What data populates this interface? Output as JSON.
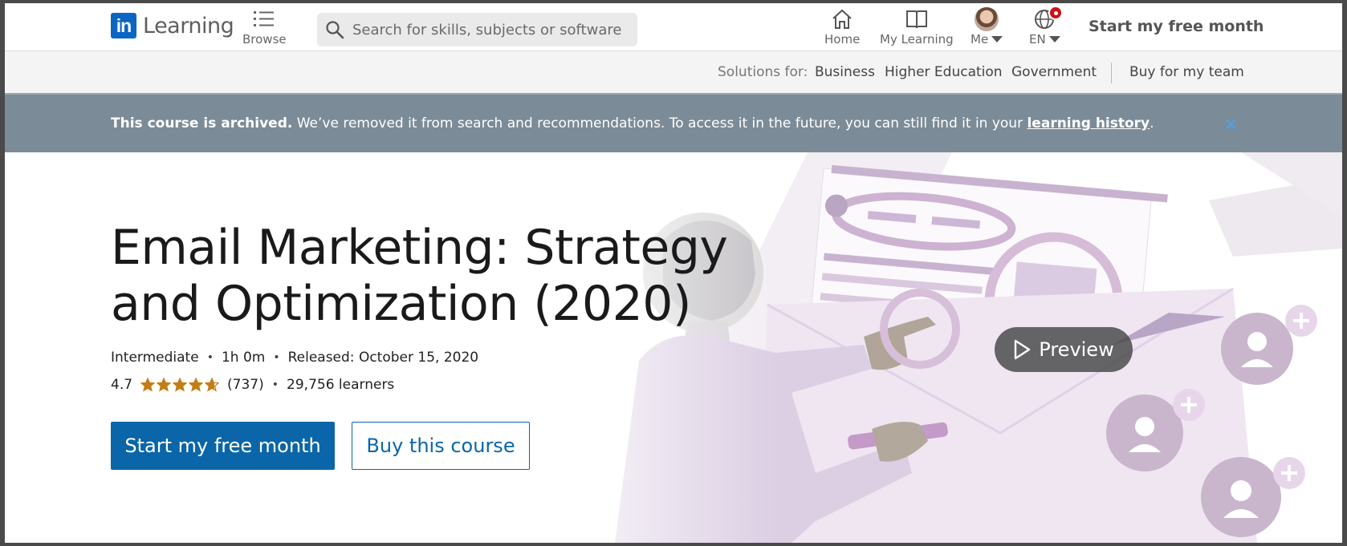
{
  "nav": {
    "logo_mark": "in",
    "logo_text": "Learning",
    "browse_label": "Browse",
    "search_placeholder": "Search for skills, subjects or software",
    "home_label": "Home",
    "my_learning_label": "My Learning",
    "me_label": "Me",
    "language_label": "EN",
    "cta_label": "Start my free month"
  },
  "subnav": {
    "solutions_label": "Solutions for:",
    "items": [
      "Business",
      "Higher Education",
      "Government"
    ],
    "team_label": "Buy for my team"
  },
  "banner": {
    "bold": "This course is archived.",
    "text": " We’ve removed it from search and recommendations. To access it in the future, you can still find it in your ",
    "link": "learning history",
    "end": ".",
    "close_glyph": "✕"
  },
  "course": {
    "title": "Email Marketing: Strategy and Optimization (2020)",
    "level": "Intermediate",
    "duration": "1h 0m",
    "released": "Released: October 15, 2020",
    "rating": "4.7",
    "rating_value": 4.7,
    "reviews": "(737)",
    "learners": "29,756 learners",
    "primary_cta": "Start my free month",
    "secondary_cta": "Buy this course",
    "preview_label": "Preview"
  },
  "colors": {
    "brand": "#0a66c2",
    "button": "#0a66a8",
    "banner_bg": "#7b8b97",
    "star": "#c37d16",
    "notification": "#cc1016"
  },
  "icons": [
    "home-icon",
    "book-icon",
    "globe-icon",
    "search-icon",
    "list-icon",
    "play-icon",
    "close-icon",
    "star-icon"
  ]
}
